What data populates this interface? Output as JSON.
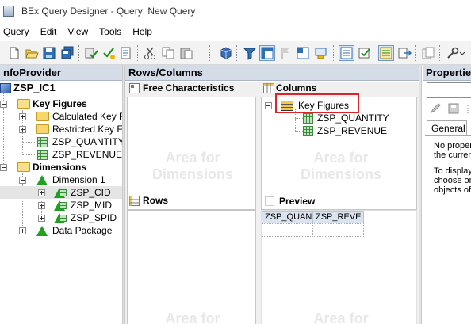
{
  "window": {
    "title": "BEx Query Designer - Query: New Query"
  },
  "menu": [
    "Query",
    "Edit",
    "View",
    "Tools",
    "Help"
  ],
  "toolbar": {
    "buttons": [
      "new-icon",
      "open-icon",
      "save-icon",
      "save-all-icon",
      "check-icon",
      "execute-icon",
      "cut-icon",
      "copy-icon",
      "paste-icon",
      "infoprovider-icon",
      "filter-icon",
      "rows-columns-icon",
      "flag-icon",
      "cells-icon",
      "conditions-icon",
      "properties-icon",
      "tasks-icon",
      "messages-icon",
      "where-used-icon",
      "more-icon",
      "tools-icon"
    ]
  },
  "infoprovider": {
    "title": "nfoProvider",
    "root": "ZSP_IC1",
    "key_figures_label": "Key Figures",
    "calculated_label": "Calculated Key Fig",
    "restricted_label": "Restricted Key Fig",
    "kf1": "ZSP_QUANTITY",
    "kf2": "ZSP_REVENUE",
    "dimensions_label": "Dimensions",
    "dimension1_label": "Dimension 1",
    "char1": "ZSP_CID",
    "char2": "ZSP_MID",
    "char3": "ZSP_SPID",
    "data_package_label": "Data Package"
  },
  "rows_columns": {
    "title": "Rows/Columns",
    "free_characteristics": "Free Characteristics",
    "columns": "Columns",
    "rows": "Rows",
    "preview": "Preview",
    "area_line1": "Area for",
    "area_line2": "Dimensions",
    "columns_tree": {
      "key_figures": "Key Figures",
      "item1": "ZSP_QUANTITY",
      "item2": "ZSP_REVENUE"
    },
    "preview_columns": [
      "ZSP_QUAN",
      "ZSP_REVE"
    ]
  },
  "properties": {
    "title": "Propertie",
    "tab_general": "General",
    "line1": "No proper",
    "line2": "the curren",
    "line3": "To display",
    "line4": "choose on",
    "line5": "objects of"
  },
  "colors": {
    "panel_header": "#d4dce7",
    "highlight": "#d9252a",
    "watermark": "#e8e8e8"
  }
}
